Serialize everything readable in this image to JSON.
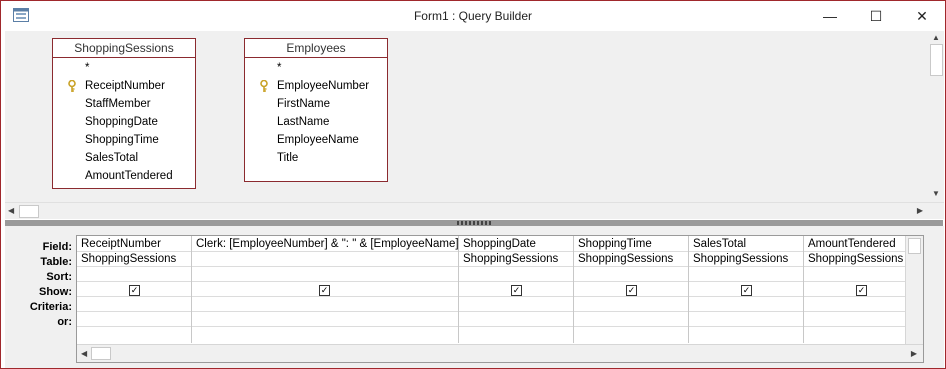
{
  "window": {
    "title": "Form1 : Query Builder",
    "minimize_glyph": "—",
    "maximize_glyph": "☐",
    "close_glyph": "✕"
  },
  "tables": [
    {
      "title": "ShoppingSessions",
      "fields": [
        {
          "name": "*",
          "key": false
        },
        {
          "name": "ReceiptNumber",
          "key": true
        },
        {
          "name": "StaffMember",
          "key": false
        },
        {
          "name": "ShoppingDate",
          "key": false
        },
        {
          "name": "ShoppingTime",
          "key": false
        },
        {
          "name": "SalesTotal",
          "key": false
        },
        {
          "name": "AmountTendered",
          "key": false
        }
      ]
    },
    {
      "title": "Employees",
      "fields": [
        {
          "name": "*",
          "key": false
        },
        {
          "name": "EmployeeNumber",
          "key": true
        },
        {
          "name": "FirstName",
          "key": false
        },
        {
          "name": "LastName",
          "key": false
        },
        {
          "name": "EmployeeName",
          "key": false
        },
        {
          "name": "Title",
          "key": false
        }
      ]
    }
  ],
  "grid": {
    "row_labels": [
      "Field:",
      "Table:",
      "Sort:",
      "Show:",
      "Criteria:",
      "or:"
    ],
    "columns": [
      {
        "field": "ReceiptNumber",
        "table": "ShoppingSessions",
        "show": true
      },
      {
        "field": "Clerk: [EmployeeNumber] & \": \" & [EmployeeName]",
        "table": "",
        "show": true
      },
      {
        "field": "ShoppingDate",
        "table": "ShoppingSessions",
        "show": true
      },
      {
        "field": "ShoppingTime",
        "table": "ShoppingSessions",
        "show": true
      },
      {
        "field": "SalesTotal",
        "table": "ShoppingSessions",
        "show": true
      },
      {
        "field": "AmountTendered",
        "table": "ShoppingSessions",
        "show": true
      }
    ]
  },
  "colors": {
    "border_accent": "#a0282c",
    "panel_bg": "#f0f0f0",
    "key_icon": "#c9a227"
  },
  "icons": {
    "app": "query-builder-app-icon",
    "key": "primary-key-icon",
    "checkbox": "checkbox-checked-icon"
  }
}
